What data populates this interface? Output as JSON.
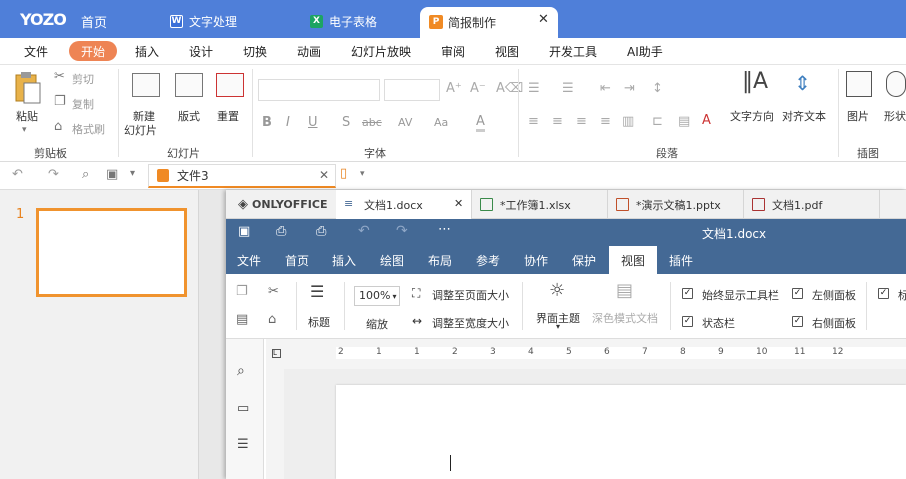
{
  "app": {
    "logo": "YOZO",
    "home": "首页",
    "tabs": [
      {
        "label": "文字处理",
        "icon": "W"
      },
      {
        "label": "电子表格",
        "icon": "X"
      },
      {
        "label": "简报制作",
        "icon": "P"
      }
    ]
  },
  "menu": [
    "文件",
    "开始",
    "插入",
    "设计",
    "切换",
    "动画",
    "幻灯片放映",
    "审阅",
    "视图",
    "开发工具",
    "AI助手"
  ],
  "ribbon": {
    "clipboard": {
      "paste": "粘贴",
      "cut": "剪切",
      "copy": "复制",
      "format_painter": "格式刷",
      "group": "剪贴板"
    },
    "slides": {
      "new_slide_1": "新建",
      "new_slide_2": "幻灯片",
      "layout": "版式",
      "reset": "重置",
      "group": "幻灯片"
    },
    "font": {
      "group": "字体",
      "bold": "B",
      "italic": "I",
      "underline": "U",
      "shadow": "S",
      "strike": "abc",
      "spacing": "AV",
      "case": "Aa",
      "color": "A"
    },
    "paragraph": {
      "group": "段落",
      "text_direction": "文字方向",
      "align_text": "对齐文本"
    },
    "insert": {
      "picture": "图片",
      "shape": "形状",
      "group": "插图"
    }
  },
  "quick": {
    "doc_tab": "文件3"
  },
  "slides_panel": {
    "number": "1"
  },
  "onlyoffice": {
    "brand": "ONLYOFFICE",
    "tabs": [
      "文档1.docx",
      "*工作簿1.xlsx",
      "*演示文稿1.pptx",
      "文档1.pdf"
    ],
    "title": "文档1.docx",
    "menu": [
      "文件",
      "首页",
      "插入",
      "绘图",
      "布局",
      "参考",
      "协作",
      "保护",
      "视图",
      "插件"
    ],
    "toolbar": {
      "heading": "标题",
      "zoom_value": "100%",
      "zoom_label": "缩放",
      "fit_page": "调整至页面大小",
      "fit_width": "调整至宽度大小",
      "ui_theme": "界面主题",
      "dark_mode": "深色模式文档",
      "always_toolbar": "始终显示工具栏",
      "statusbar": "状态栏",
      "left_panel": "左侧面板",
      "right_panel": "右侧面板",
      "extra": "标"
    },
    "ruler": [
      "2",
      "1",
      "1",
      "2",
      "3",
      "4",
      "5",
      "6",
      "7",
      "8",
      "9",
      "10",
      "11",
      "12"
    ]
  }
}
